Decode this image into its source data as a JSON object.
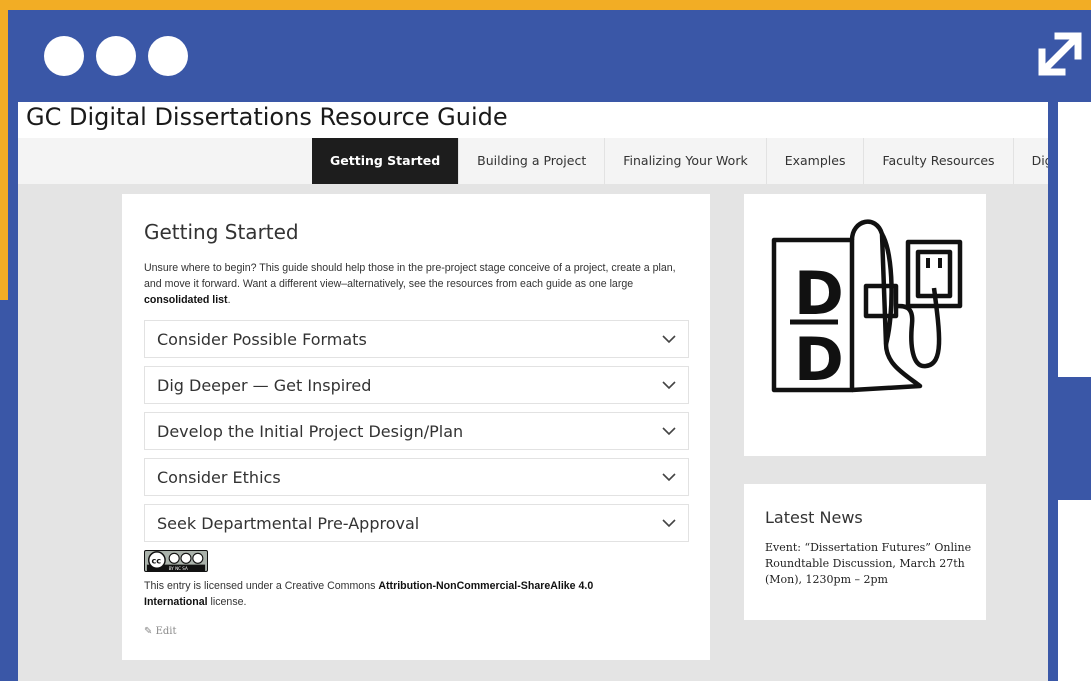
{
  "site": {
    "title": "GC Digital Dissertations Resource Guide"
  },
  "nav": {
    "items": [
      {
        "label": "Getting Started",
        "active": true
      },
      {
        "label": "Building a Project",
        "active": false
      },
      {
        "label": "Finalizing Your Work",
        "active": false
      },
      {
        "label": "Examples",
        "active": false
      },
      {
        "label": "Faculty Resources",
        "active": false
      },
      {
        "label": "DigitalDiss Po",
        "active": false
      }
    ]
  },
  "main": {
    "title": "Getting Started",
    "intro_text": "Unsure where to begin? This guide should help those in the pre-project stage conceive of a project, create a plan, and move it forward. Want a different view–alternatively, see the resources from each guide as one large",
    "intro_link": "consolidated list",
    "intro_end": ".",
    "sections": [
      "Consider Possible Formats",
      "Dig Deeper — Get Inspired",
      "Develop the Initial Project Design/Plan",
      "Consider Ethics",
      "Seek Departmental Pre-Approval"
    ],
    "license_prefix": "This entry is licensed under a Creative Commons",
    "license_name": "Attribution-NonCommercial-ShareAlike 4.0 International",
    "license_suffix": "license.",
    "edit_label": "Edit",
    "cc_badge_text": "BY NC SA"
  },
  "sidebar": {
    "logo_letters": "D D",
    "news_title": "Latest News",
    "news_item": "Event: “Dissertation Futures” Online Roundtable Discussion, March 27th (Mon), 1230pm – 2pm"
  },
  "colors": {
    "frame_blue": "#3a57a7",
    "accent_yellow": "#f2ad25",
    "nav_active": "#1d1d1d"
  },
  "icons": {
    "window_controls": "three-dots-icon",
    "expand": "expand-arrows-icon",
    "accordion": "chevron-down-icon",
    "edit": "pencil-icon"
  }
}
